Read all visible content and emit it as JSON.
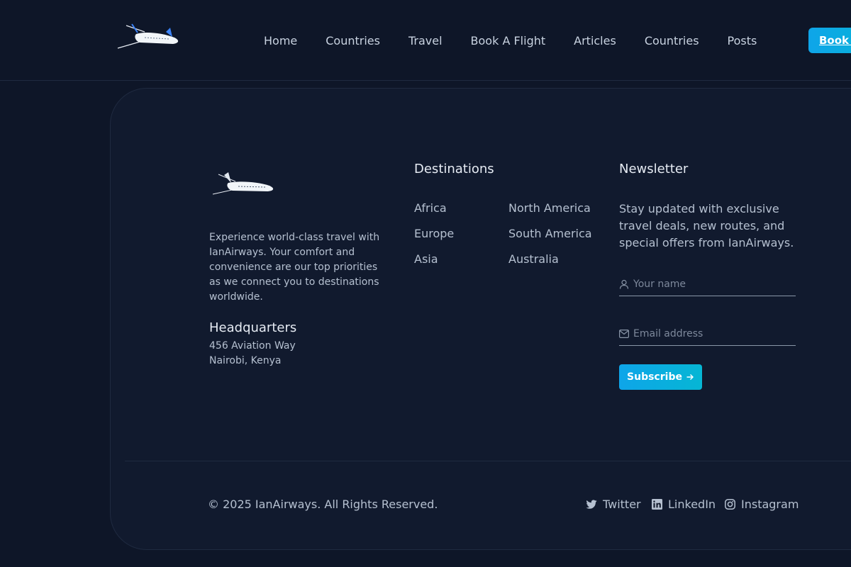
{
  "header": {
    "nav": [
      "Home",
      "Countries",
      "Travel",
      "Book A Flight",
      "Articles",
      "Countries",
      "Posts"
    ],
    "book_button": "Book a Flight"
  },
  "footer": {
    "about": "Experience world-class travel with IanAirways. Your comfort and convenience are our top priorities as we connect you to destinations worldwide.",
    "hq_title": "Headquarters",
    "hq_address": [
      "456 Aviation Way",
      "Nairobi, Kenya"
    ],
    "destinations": {
      "title": "Destinations",
      "items": [
        "Africa",
        "North America",
        "Europe",
        "South America",
        "Asia",
        "Australia"
      ]
    },
    "newsletter": {
      "title": "Newsletter",
      "text": "Stay updated with exclusive travel deals, new routes, and special offers from IanAirways.",
      "name_placeholder": "Your name",
      "email_placeholder": "Email address",
      "subscribe": "Subscribe"
    },
    "copyright": "© 2025 IanAirways. All Rights Reserved.",
    "social": [
      "Twitter",
      "LinkedIn",
      "Instagram"
    ]
  },
  "colors": {
    "background": "#0e1628",
    "card": "#111a2e",
    "accent": "#0ea5e9"
  }
}
